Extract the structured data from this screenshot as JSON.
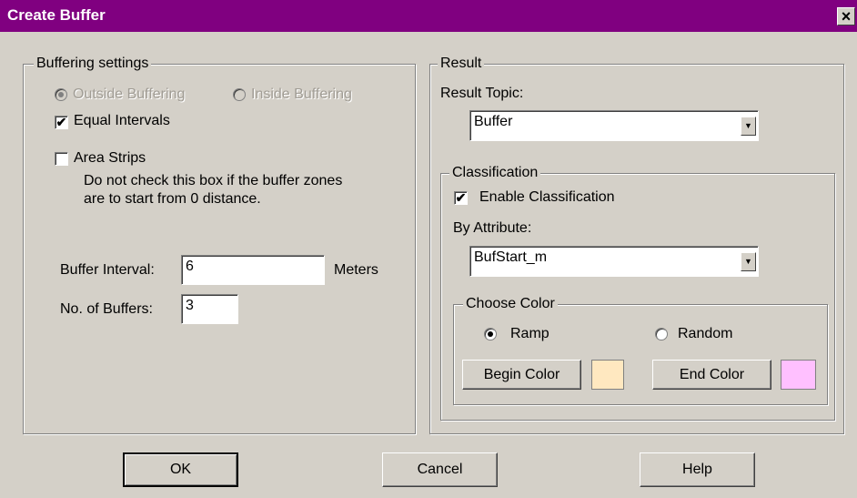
{
  "window": {
    "title": "Create Buffer",
    "close_symbol": "×"
  },
  "buffering": {
    "legend": "Buffering settings",
    "outside_label": "Outside Buffering",
    "inside_label": "Inside Buffering",
    "equal_intervals_label": "Equal Intervals",
    "equal_intervals_checked": true,
    "area_strips_label": "Area Strips",
    "area_strips_checked": false,
    "note_line1": "Do not check this box if the buffer zones",
    "note_line2": "are to start from 0 distance.",
    "interval_label": "Buffer Interval:",
    "interval_value": "6",
    "interval_unit": "Meters",
    "count_label": "No. of Buffers:",
    "count_value": "3"
  },
  "result": {
    "legend": "Result",
    "topic_label": "Result Topic:",
    "topic_value": "Buffer",
    "classification": {
      "legend": "Classification",
      "enable_label": "Enable Classification",
      "enable_checked": true,
      "attribute_label": "By Attribute:",
      "attribute_value": "BufStart_m",
      "color": {
        "legend": "Choose Color",
        "ramp_label": "Ramp",
        "random_label": "Random",
        "selected": "Ramp",
        "begin_label": "Begin Color",
        "end_label": "End Color",
        "begin_color": "#ffe8c0",
        "end_color": "#ffc0ff"
      }
    }
  },
  "footer": {
    "ok_label": "OK",
    "cancel_label": "Cancel",
    "help_label": "Help"
  },
  "glyphs": {
    "check": "✔",
    "down_arrow": "▼"
  },
  "colors": {
    "titlebar": "#800080",
    "dialog_bg": "#d4d0c8"
  }
}
